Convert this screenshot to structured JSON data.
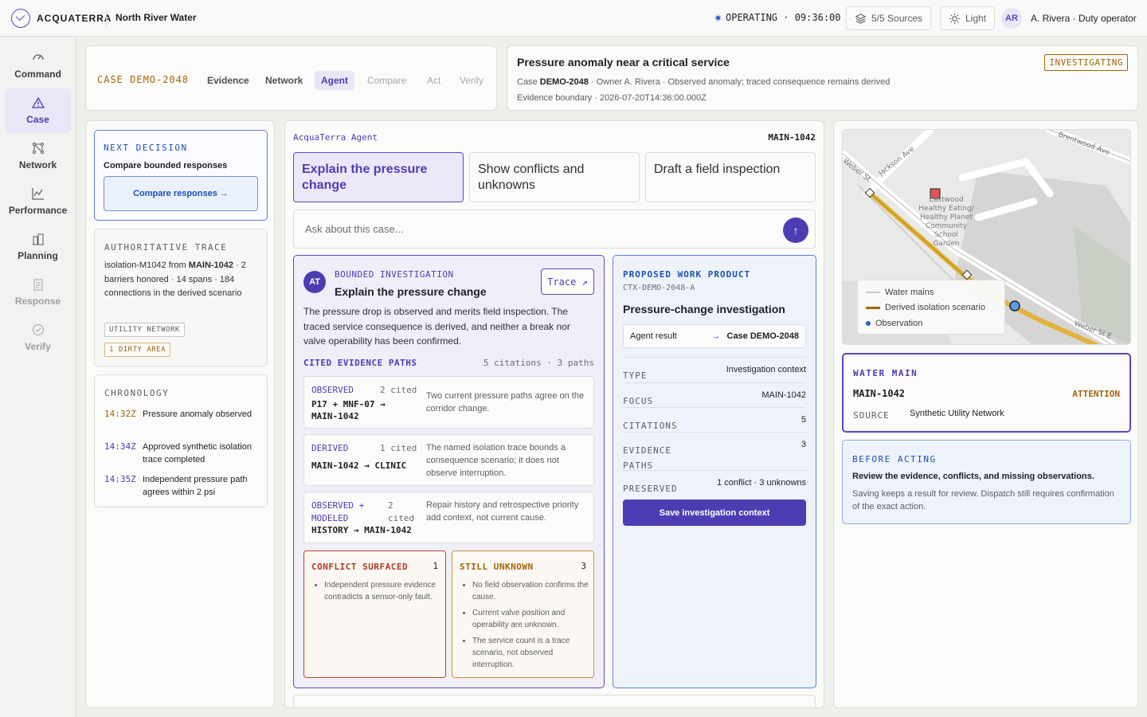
{
  "app": {
    "brand": "ACQUATERRA",
    "utility": "North River Water"
  },
  "topbar": {
    "status": "OPERATING · 09:36:00",
    "sources": "5/5 Sources",
    "theme": "Light",
    "avatar": "AR",
    "operator": "A. Rivera · Duty operator"
  },
  "sidebar": [
    {
      "label": "Command",
      "icon": "gauge-icon"
    },
    {
      "label": "Case",
      "icon": "warning-icon",
      "active": true
    },
    {
      "label": "Network",
      "icon": "network-icon"
    },
    {
      "label": "Performance",
      "icon": "chart-icon"
    },
    {
      "label": "Planning",
      "icon": "buildings-icon"
    },
    {
      "label": "Response",
      "icon": "clipboard-icon",
      "dim": true
    },
    {
      "label": "Verify",
      "icon": "check-circle-icon",
      "dim": true
    }
  ],
  "casebar": {
    "code": "CASE DEMO-2048",
    "tabs": [
      "Evidence",
      "Network",
      "Agent",
      "Compare",
      "Act",
      "Verify"
    ]
  },
  "header": {
    "title": "Pressure anomaly near a critical service",
    "badge": "INVESTIGATING",
    "meta_prefix": "Case ",
    "meta_case": "DEMO-2048",
    "meta_rest": " · Owner A. Rivera · Observed anomaly; traced consequence remains derived",
    "boundary": "Evidence boundary · 2026-07-20T14:36:00.000Z"
  },
  "next_decision": {
    "label": "NEXT DECISION",
    "text": "Compare bounded responses",
    "button": "Compare responses →"
  },
  "trace": {
    "label": "AUTHORITATIVE TRACE",
    "line_a": "isolation-M1042 from ",
    "line_b": "MAIN-1042",
    "line_c": " · 2 barriers honored · 14 spans · 184 connections in the derived scenario",
    "tag1": "UTILITY NETWORK",
    "tag2": "1 DIRTY AREA"
  },
  "chronology": {
    "label": "CHRONOLOGY",
    "events": [
      {
        "time": "14:32Z",
        "text": "Pressure anomaly observed",
        "color": "#a3650a"
      },
      {
        "time": "14:34Z",
        "text": "Approved synthetic isolation trace completed",
        "color": "#4d3db3"
      },
      {
        "time": "14:35Z",
        "text": "Independent pressure path agrees within 2 psi",
        "color": "#4d3db3"
      }
    ]
  },
  "agent": {
    "title": "AcquaTerra Agent",
    "asset": "MAIN-1042",
    "quick": [
      "Explain the pressure change",
      "Show conflicts and unknowns",
      "Draft a field inspection"
    ],
    "ask_placeholder": "Ask about this case...",
    "send": "↑"
  },
  "investigation": {
    "avatar": "AT",
    "label": "BOUNDED INVESTIGATION",
    "title": "Explain the pressure change",
    "trace_button": "Trace ↗",
    "description": "The pressure drop is observed and merits field inspection. The traced service consequence is derived, and neither a break nor valve operability has been confirmed.",
    "paths_label": "CITED EVIDENCE PATHS",
    "paths_count": "5 citations · 3 paths",
    "paths": [
      {
        "kind": "OBSERVED",
        "cited": "2 cited",
        "route": "P17 + MNF-07 → MAIN-1042",
        "desc": "Two current pressure paths agree on the corridor change."
      },
      {
        "kind": "DERIVED",
        "cited": "1 cited",
        "route": "MAIN-1042 → CLINIC",
        "desc": "The named isolation trace bounds a consequence scenario; it does not observe interruption."
      },
      {
        "kind": "OBSERVED + MODELED",
        "cited": "2 cited",
        "route": "HISTORY → MAIN-1042",
        "desc": "Repair history and retrospective priority add context, not current cause."
      }
    ],
    "conflict": {
      "label": "CONFLICT SURFACED",
      "count": "1",
      "items": [
        "Independent pressure evidence contradicts a sensor-only fault."
      ]
    },
    "unknown": {
      "label": "STILL UNKNOWN",
      "count": "3",
      "items": [
        "No field observation confirms the cause.",
        "Current valve position and operability are unknown.",
        "The service count is a trace scenario, not observed interruption."
      ]
    }
  },
  "work_product": {
    "label": "PROPOSED WORK PRODUCT",
    "id": "CTX-DEMO-2048-A",
    "title": "Pressure-change investigation",
    "link_left": "Agent result",
    "link_arrow": "→",
    "link_right": "Case DEMO-2048",
    "rows": [
      {
        "k": "TYPE",
        "v": "Investigation context"
      },
      {
        "k": "FOCUS",
        "v": "MAIN-1042"
      },
      {
        "k": "CITATIONS",
        "v": "5"
      },
      {
        "k": "EVIDENCE PATHS",
        "v": "3"
      },
      {
        "k": "PRESERVED",
        "v": "1 conflict · 3 unknowns"
      }
    ],
    "save": "Save investigation context"
  },
  "map": {
    "streets": [
      "Jackson Ave",
      "Brentwood Ave",
      "Weber St",
      "Weber St E"
    ],
    "poi": [
      "Eastwood",
      "Healthy Eating/",
      "Healthy Planet",
      "Community",
      "School",
      "Garden"
    ],
    "legend": [
      "Water mains",
      "Derived isolation scenario",
      "Observation"
    ],
    "colors": {
      "main": "#e3b33a",
      "observation": "#2563c9",
      "asset": "#e05555"
    }
  },
  "water_main": {
    "label": "WATER MAIN",
    "id": "MAIN-1042",
    "attention": "ATTENTION",
    "source_label": "SOURCE",
    "source": "Synthetic Utility Network"
  },
  "before_acting": {
    "label": "BEFORE ACTING",
    "text": "Review the evidence, conflicts, and missing observations.",
    "sub": "Saving keeps a result for review. Dispatch still requires confirmation of the exact action."
  }
}
